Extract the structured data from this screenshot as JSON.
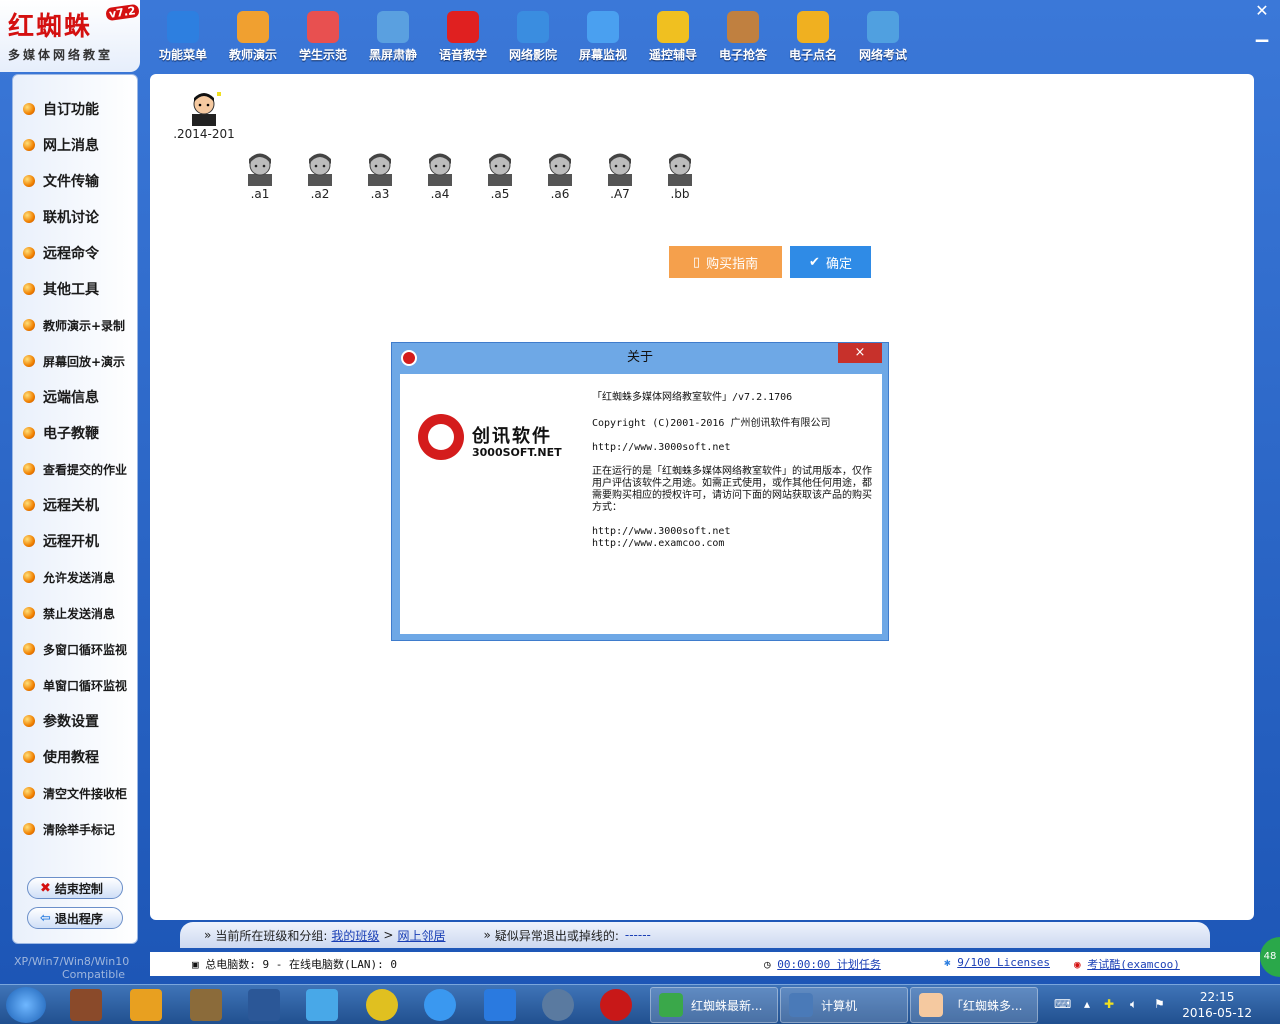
{
  "app": {
    "logo_title": "红蜘蛛",
    "logo_version": "v7.2",
    "logo_subtitle": "多媒体网络教室",
    "compat_line1": "XP/Win7/Win8/Win10",
    "compat_line2": "Compatible"
  },
  "toolbar": [
    {
      "label": "功能菜单",
      "icon": "gear-icon",
      "color": "#2d7fe0"
    },
    {
      "label": "教师演示",
      "icon": "teacher-icon",
      "color": "#f0a030"
    },
    {
      "label": "学生示范",
      "icon": "students-icon",
      "color": "#e85050"
    },
    {
      "label": "黑屏肃静",
      "icon": "laptop-icon",
      "color": "#5aa0e0"
    },
    {
      "label": "语音教学",
      "icon": "megaphone-icon",
      "color": "#e02020"
    },
    {
      "label": "网络影院",
      "icon": "film-icon",
      "color": "#3a8de0"
    },
    {
      "label": "屏幕监视",
      "icon": "monitor-icon",
      "color": "#4aa0f0"
    },
    {
      "label": "遥控辅导",
      "icon": "satellite-icon",
      "color": "#f0c020"
    },
    {
      "label": "电子抢答",
      "icon": "quiz-icon",
      "color": "#c08040"
    },
    {
      "label": "电子点名",
      "icon": "rollcall-icon",
      "color": "#f0b020"
    },
    {
      "label": "网络考试",
      "icon": "exam-icon",
      "color": "#50a0e0"
    }
  ],
  "sidebar": {
    "items": [
      {
        "label": "自订功能",
        "small": false
      },
      {
        "label": "网上消息",
        "small": false
      },
      {
        "label": "文件传输",
        "small": false
      },
      {
        "label": "联机讨论",
        "small": false
      },
      {
        "label": "远程命令",
        "small": false
      },
      {
        "label": "其他工具",
        "small": false
      },
      {
        "label": "教师演示+录制",
        "small": true
      },
      {
        "label": "屏幕回放+演示",
        "small": true
      },
      {
        "label": "远端信息",
        "small": false
      },
      {
        "label": "电子教鞭",
        "small": false
      },
      {
        "label": "查看提交的作业",
        "small": true
      },
      {
        "label": "远程关机",
        "small": false
      },
      {
        "label": "远程开机",
        "small": false
      },
      {
        "label": "允许发送消息",
        "small": true
      },
      {
        "label": "禁止发送消息",
        "small": true
      },
      {
        "label": "多窗口循环监视",
        "small": true
      },
      {
        "label": "单窗口循环监视",
        "small": true
      },
      {
        "label": "参数设置",
        "small": false
      },
      {
        "label": "使用教程",
        "small": false
      },
      {
        "label": "清空文件接收柜",
        "small": true
      },
      {
        "label": "清除举手标记",
        "small": true
      }
    ],
    "end_control": "结束控制",
    "exit_program": "退出程序"
  },
  "computers": {
    "teacher": ".2014-201",
    "students": [
      ".a1",
      ".a2",
      ".a3",
      ".a4",
      ".a5",
      ".a6",
      ".A7",
      ".bb"
    ]
  },
  "about_dialog": {
    "title": "关于",
    "close": "×",
    "brand_name": "创讯软件",
    "brand_url": "3000SOFT.NET",
    "product": "「红蜘蛛多媒体网络教室软件」/v7.2.1706",
    "copyright": "Copyright (C)2001-2016 广州创讯软件有限公司",
    "website": "http://www.3000soft.net",
    "notice": "正在运行的是「红蜘蛛多媒体网络教室软件」的试用版本，仅作用户评估该软件之用途。如需正式使用，或作其他任何用途，都需要购买相应的授权许可，请访问下面的网站获取该产品的购买方式：",
    "url1": "http://www.3000soft.net",
    "url2": "http://www.examcoo.com",
    "buy_label": "购买指南",
    "ok_label": "确定"
  },
  "crumb": {
    "prefix": "当前所在班级和分组:",
    "class": "我的班级",
    "separator": ">",
    "group": "网上邻居",
    "abnormal_label": "疑似异常退出或掉线的:",
    "abnormal_value": "------"
  },
  "status": {
    "total": "总电脑数: 9  -  在线电脑数(LAN): 0",
    "timer": "00:00:00 计划任务",
    "licenses": "9/100 Licenses",
    "exam": "考试酷(examcoo)"
  },
  "taskbar": {
    "tasks": [
      "红蜘蛛最新...",
      "计算机",
      "「红蜘蛛多..."
    ],
    "time": "22:15",
    "date": "2016-05-12",
    "badge": "48"
  }
}
